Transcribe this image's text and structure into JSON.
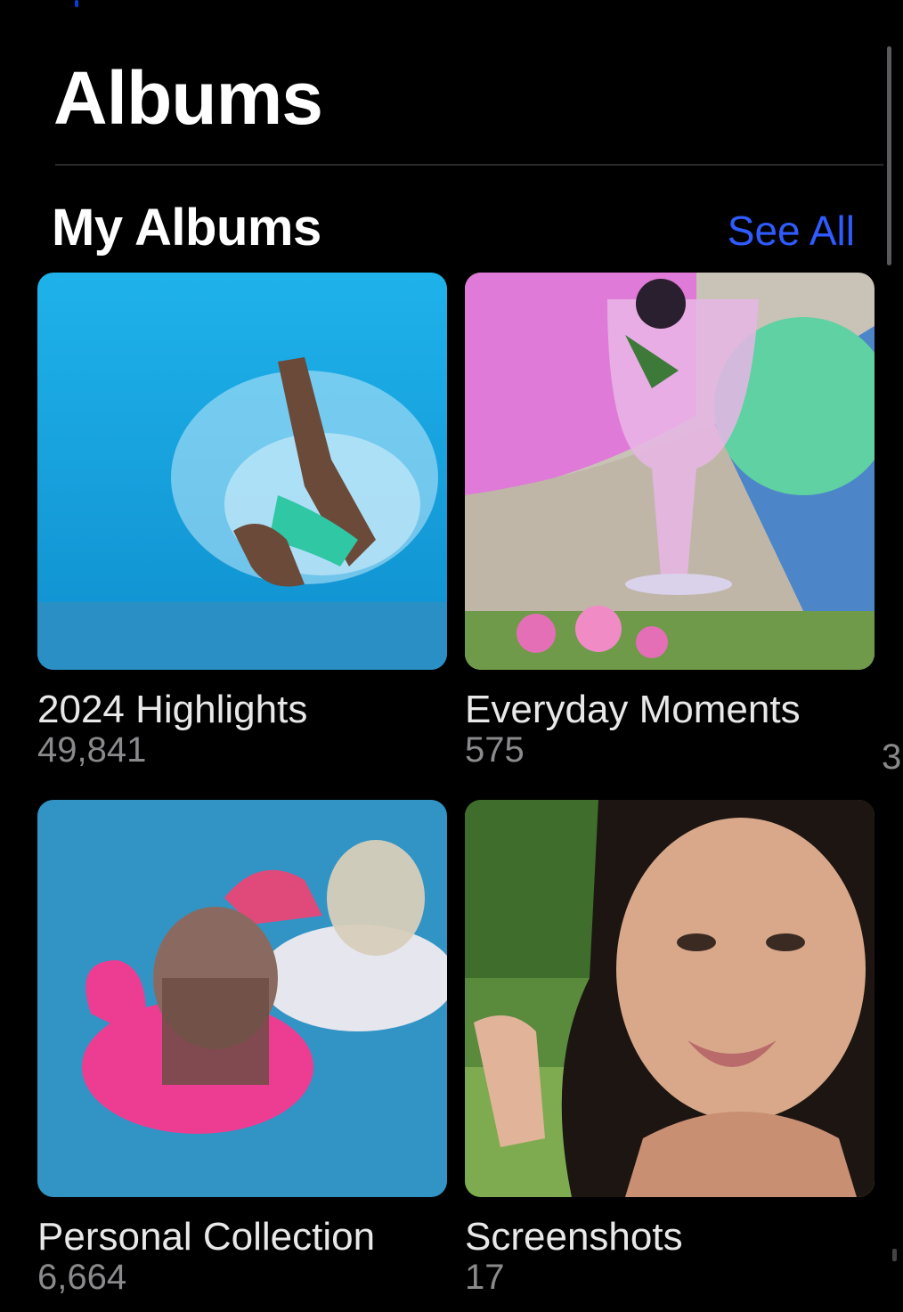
{
  "header": {
    "title": "Albums"
  },
  "section": {
    "title": "My Albums",
    "see_all_label": "See All"
  },
  "albums": [
    {
      "name": "2024 Highlights",
      "count": "49,841"
    },
    {
      "name": "Everyday Moments",
      "count": "575"
    },
    {
      "name": "Personal Collection",
      "count": "6,664"
    },
    {
      "name": "Screenshots",
      "count": "17"
    }
  ],
  "peek_count": "3",
  "colors": {
    "accent": "#2f5bff",
    "background": "#000000",
    "secondary_text": "#8a8a8d"
  }
}
